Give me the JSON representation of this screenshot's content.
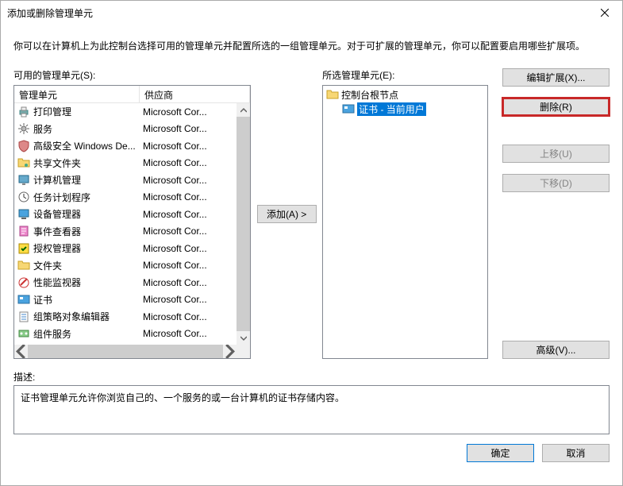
{
  "titlebar": {
    "title": "添加或删除管理单元"
  },
  "intro": "你可以在计算机上为此控制台选择可用的管理单元并配置所选的一组管理单元。对于可扩展的管理单元，你可以配置要启用哪些扩展项。",
  "available": {
    "label": "可用的管理单元(S):",
    "headers": {
      "name": "管理单元",
      "vendor": "供应商"
    },
    "rows": [
      {
        "icon": "printer-icon",
        "name": "打印管理",
        "vendor": "Microsoft Cor..."
      },
      {
        "icon": "gear-icon",
        "name": "服务",
        "vendor": "Microsoft Cor..."
      },
      {
        "icon": "shield-icon",
        "name": "高级安全 Windows De...",
        "vendor": "Microsoft Cor..."
      },
      {
        "icon": "folder-share-icon",
        "name": "共享文件夹",
        "vendor": "Microsoft Cor..."
      },
      {
        "icon": "computer-manage-icon",
        "name": "计算机管理",
        "vendor": "Microsoft Cor..."
      },
      {
        "icon": "clock-icon",
        "name": "任务计划程序",
        "vendor": "Microsoft Cor..."
      },
      {
        "icon": "device-icon",
        "name": "设备管理器",
        "vendor": "Microsoft Cor..."
      },
      {
        "icon": "event-icon",
        "name": "事件查看器",
        "vendor": "Microsoft Cor..."
      },
      {
        "icon": "auth-icon",
        "name": "授权管理器",
        "vendor": "Microsoft Cor..."
      },
      {
        "icon": "folder-icon",
        "name": "文件夹",
        "vendor": "Microsoft Cor..."
      },
      {
        "icon": "perf-icon",
        "name": "性能监视器",
        "vendor": "Microsoft Cor..."
      },
      {
        "icon": "cert-icon",
        "name": "证书",
        "vendor": "Microsoft Cor..."
      },
      {
        "icon": "gpo-icon",
        "name": "组策略对象编辑器",
        "vendor": "Microsoft Cor..."
      },
      {
        "icon": "component-icon",
        "name": "组件服务",
        "vendor": "Microsoft Cor..."
      }
    ]
  },
  "selected": {
    "label": "所选管理单元(E):",
    "root": "控制台根节点",
    "item": "证书 - 当前用户"
  },
  "buttons": {
    "add": "添加(A) >",
    "edit_ext": "编辑扩展(X)...",
    "remove": "删除(R)",
    "move_up": "上移(U)",
    "move_down": "下移(D)",
    "advanced": "高级(V)...",
    "ok": "确定",
    "cancel": "取消"
  },
  "description": {
    "label": "描述:",
    "text": "证书管理单元允许你浏览自己的、一个服务的或一台计算机的证书存储内容。"
  }
}
